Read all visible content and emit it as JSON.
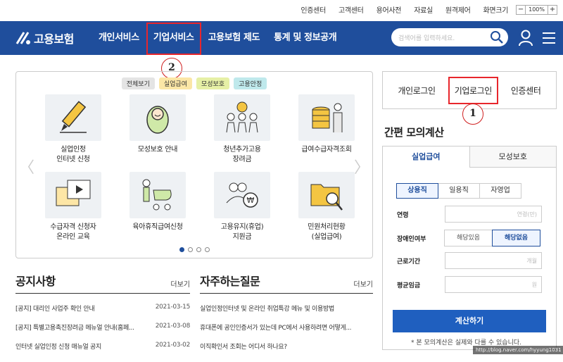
{
  "util": {
    "links": [
      "인증센터",
      "고객센터",
      "용어사전",
      "자료실",
      "원격제어",
      "화면크기"
    ],
    "zoom_minus": "−",
    "zoom_value": "100%",
    "zoom_plus": "+"
  },
  "nav": {
    "logo_text": "고용보험",
    "menu": [
      "개인서비스",
      "기업서비스",
      "고용보험 제도",
      "통계 및 정보공개"
    ],
    "search_placeholder": "검색어를 입력하세요."
  },
  "annotations": {
    "first": "1",
    "second": "2"
  },
  "panel": {
    "chips": [
      {
        "label": "전체보기",
        "color": "#e4e4e4"
      },
      {
        "label": "실업급여",
        "color": "#fbe6a6"
      },
      {
        "label": "모성보호",
        "color": "#e6f0a6"
      },
      {
        "label": "고용안정",
        "color": "#bfe9ec"
      }
    ],
    "services": [
      {
        "label": "실업인정\n인터넷 신청",
        "icon": "pencil-icon"
      },
      {
        "label": "모성보호 안내",
        "icon": "baby-icon"
      },
      {
        "label": "청년추가고용\n장려금",
        "icon": "people-coin-icon"
      },
      {
        "label": "급여수급자격조회",
        "icon": "coins-man-icon"
      },
      {
        "label": "수급자격 신청자\n온라인 교육",
        "icon": "video-icon"
      },
      {
        "label": "육아휴직급여신청",
        "icon": "stroller-icon"
      },
      {
        "label": "고용유지(휴업)\n지원금",
        "icon": "people-won-icon"
      },
      {
        "label": "민원처리현황\n(실업급여)",
        "icon": "folder-search-icon"
      }
    ],
    "arrow_left": "〈",
    "arrow_right": "〉"
  },
  "notice": {
    "title": "공지사항",
    "more": "더보기",
    "items": [
      {
        "text": "[공지] 대리인 사업주 확인 안내",
        "date": "2021-03-15"
      },
      {
        "text": "[공지] 특별고용촉진장려금 메뉴얼 안내(홈페...",
        "date": "2021-03-08"
      },
      {
        "text": "인터넷 실업인정 신청 매뉴얼 공지",
        "date": "2021-03-02"
      }
    ]
  },
  "faq": {
    "title": "자주하는질문",
    "more": "더보기",
    "items": [
      "실업인정인터넷 및 온라인 취업특강 메뉴 및 이용방법",
      "휴대폰에 공인인증서가 있는데 PC에서 사용하려면 어떻게...",
      "이직확인서 조회는 어디서 하나요?"
    ]
  },
  "login": {
    "personal": "개인로그인",
    "company": "기업로그인",
    "cert": "인증센터"
  },
  "calc": {
    "title": "간편 모의계산",
    "tabs": [
      "실업급여",
      "모성보호"
    ],
    "types": [
      "상용직",
      "일용직",
      "자영업"
    ],
    "age_label": "연령",
    "age_placeholder": "연령(만)",
    "disability_label": "장애인여부",
    "disability_options": [
      "해당있음",
      "해당없음"
    ],
    "period_label": "근로기간",
    "period_placeholder": "개월",
    "wage_label": "평균임금",
    "wage_placeholder": "원",
    "button": "계산하기",
    "note": "* 본 모의계산은 실제와 다를 수 있습니다."
  },
  "watermark": "http://blog.naver.com/hyyung1031",
  "colors": {
    "brand": "#1f4e9c",
    "highlight": "#e8262c",
    "button": "#1f5fbf"
  }
}
